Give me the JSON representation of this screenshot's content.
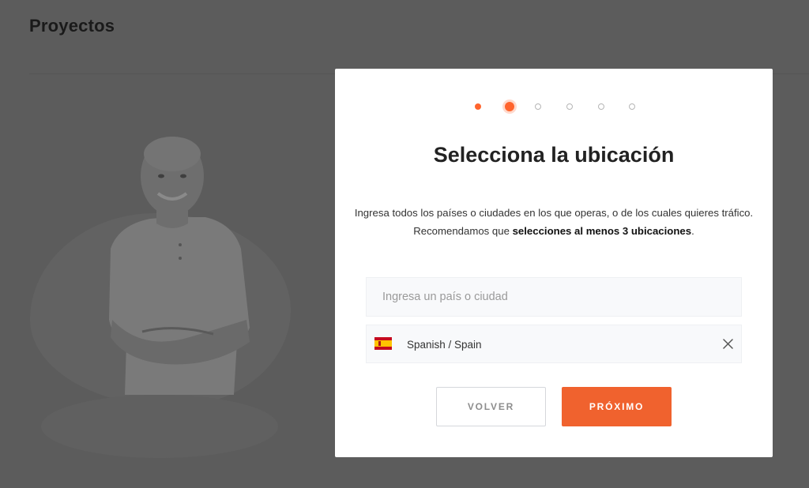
{
  "page": {
    "title": "Proyectos"
  },
  "modal": {
    "steps": [
      "done",
      "current",
      "todo",
      "todo",
      "todo",
      "todo"
    ],
    "title": "Selecciona la ubicación",
    "description_1": "Ingresa todos los países o ciudades en los que operas, o de los cuales quieres tráfico. Recomendamos que ",
    "description_bold": "selecciones al menos 3 ubicaciones",
    "description_2": ".",
    "search": {
      "placeholder": "Ingresa un país o ciudad",
      "value": ""
    },
    "locations": [
      {
        "flag_icon": "spain-flag-icon",
        "label": "Spanish / Spain"
      }
    ],
    "back_label": "VOLVER",
    "next_label": "PRÓXIMO"
  },
  "colors": {
    "accent": "#f0622e",
    "overlay": "#5c5c5c"
  }
}
